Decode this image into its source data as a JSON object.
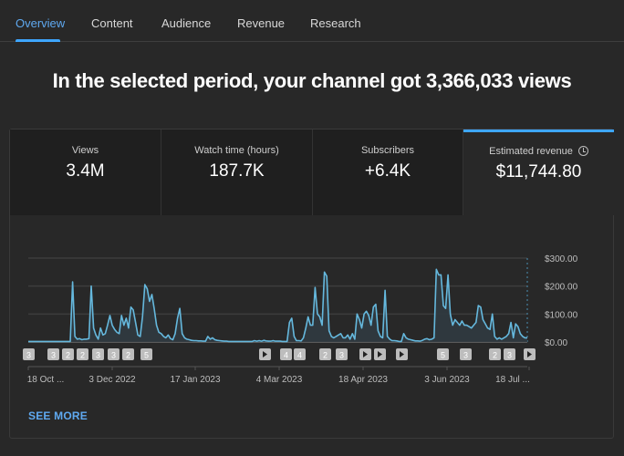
{
  "tabs": [
    {
      "label": "Overview",
      "active": true
    },
    {
      "label": "Content",
      "active": false
    },
    {
      "label": "Audience",
      "active": false
    },
    {
      "label": "Revenue",
      "active": false
    },
    {
      "label": "Research",
      "active": false
    }
  ],
  "headline": "In the selected period, your channel got 3,366,033 views",
  "metrics": [
    {
      "label": "Views",
      "value": "3.4M",
      "selected": false
    },
    {
      "label": "Watch time (hours)",
      "value": "187.7K",
      "selected": false
    },
    {
      "label": "Subscribers",
      "value": "+6.4K",
      "selected": false
    },
    {
      "label": "Estimated revenue",
      "value": "$11,744.80",
      "selected": true,
      "icon": "clock-icon"
    }
  ],
  "colors": {
    "accent": "#3ea6ff",
    "line": "#65b8dd",
    "background": "#282828"
  },
  "see_more": "SEE MORE",
  "markers": [
    {
      "label": "3",
      "type": "count"
    },
    {
      "label": "3",
      "type": "count"
    },
    {
      "label": "2",
      "type": "count"
    },
    {
      "label": "2",
      "type": "count"
    },
    {
      "label": "3",
      "type": "count"
    },
    {
      "label": "3",
      "type": "count"
    },
    {
      "label": "2",
      "type": "count"
    },
    {
      "label": "5",
      "type": "count"
    },
    {
      "label": "",
      "type": "play"
    },
    {
      "label": "4",
      "type": "count"
    },
    {
      "label": "4",
      "type": "count"
    },
    {
      "label": "2",
      "type": "count"
    },
    {
      "label": "3",
      "type": "count"
    },
    {
      "label": "",
      "type": "play"
    },
    {
      "label": "",
      "type": "play"
    },
    {
      "label": "",
      "type": "play"
    },
    {
      "label": "5",
      "type": "count"
    },
    {
      "label": "3",
      "type": "count"
    },
    {
      "label": "2",
      "type": "count"
    },
    {
      "label": "3",
      "type": "count"
    },
    {
      "label": "",
      "type": "play"
    }
  ],
  "chart_data": {
    "type": "area",
    "title": "Estimated revenue",
    "xlabel": "",
    "ylabel": "",
    "ylim": [
      0,
      300
    ],
    "yticks": [
      "$0.00",
      "$100.00",
      "$200.00",
      "$300.00"
    ],
    "xticks": [
      "18 Oct ...",
      "3 Dec 2022",
      "17 Jan 2023",
      "4 Mar 2023",
      "18 Apr 2023",
      "3 Jun 2023",
      "18 Jul ..."
    ],
    "grid": true,
    "series": [
      {
        "name": "Estimated revenue",
        "values": [
          2,
          2,
          2,
          2,
          2,
          2,
          2,
          2,
          2,
          2,
          2,
          2,
          2,
          2,
          2,
          2,
          2,
          2,
          2,
          215,
          20,
          10,
          12,
          8,
          10,
          10,
          12,
          200,
          50,
          25,
          10,
          50,
          25,
          30,
          60,
          95,
          60,
          45,
          35,
          30,
          95,
          60,
          85,
          50,
          125,
          115,
          70,
          25,
          20,
          90,
          205,
          190,
          145,
          170,
          120,
          60,
          35,
          30,
          20,
          15,
          25,
          12,
          8,
          30,
          85,
          120,
          30,
          15,
          10,
          8,
          6,
          5,
          5,
          4,
          4,
          3,
          3,
          20,
          10,
          15,
          8,
          6,
          5,
          4,
          3,
          3,
          2,
          2,
          2,
          2,
          2,
          2,
          2,
          2,
          2,
          2,
          2,
          5,
          3,
          5,
          3,
          6,
          4,
          3,
          3,
          5,
          3,
          3,
          3,
          2,
          2,
          2,
          70,
          85,
          20,
          5,
          5,
          4,
          15,
          50,
          90,
          60,
          60,
          195,
          100,
          90,
          60,
          250,
          235,
          40,
          20,
          15,
          20,
          25,
          30,
          15,
          15,
          25,
          10,
          30,
          10,
          100,
          80,
          50,
          100,
          110,
          95,
          60,
          125,
          135,
          40,
          20,
          15,
          185,
          20,
          10,
          5,
          5,
          4,
          2,
          2,
          30,
          15,
          10,
          8,
          6,
          4,
          4,
          3,
          6,
          10,
          12,
          8,
          10,
          15,
          260,
          240,
          240,
          130,
          120,
          240,
          100,
          60,
          80,
          70,
          60,
          75,
          60,
          60,
          55,
          50,
          60,
          70,
          130,
          125,
          80,
          65,
          50,
          45,
          100,
          20,
          10,
          15,
          10,
          15,
          20,
          30,
          70,
          15,
          65,
          55,
          30,
          20,
          15,
          15
        ]
      }
    ]
  }
}
